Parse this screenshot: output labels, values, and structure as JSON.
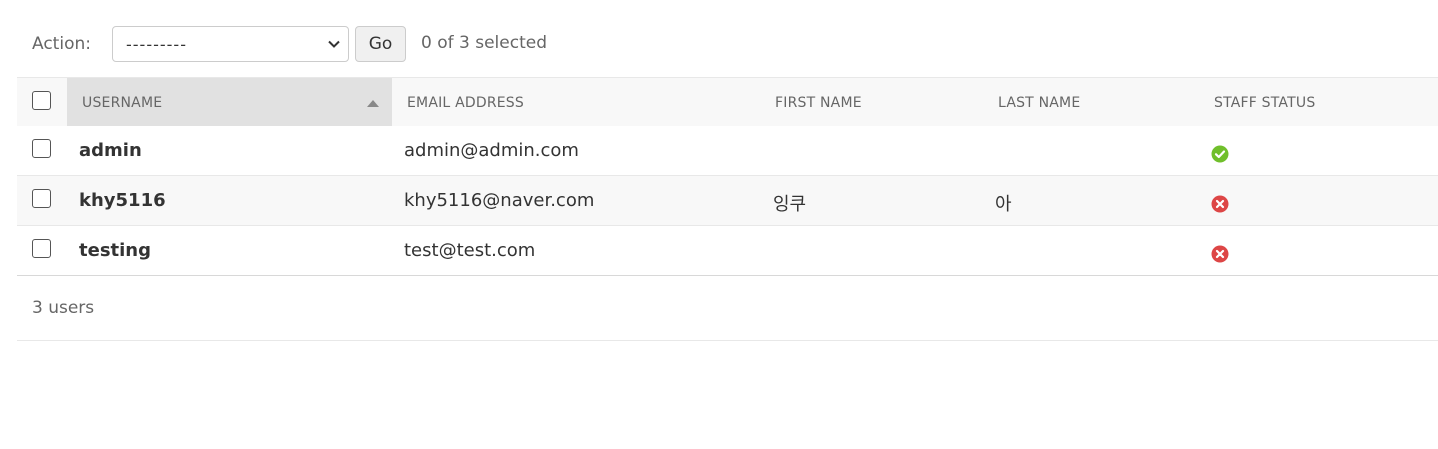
{
  "actions": {
    "label": "Action:",
    "select_value": "---------",
    "go_label": "Go",
    "selected_count": "0 of 3 selected"
  },
  "table": {
    "columns": [
      "Username",
      "Email address",
      "First name",
      "Last name",
      "Staff status"
    ],
    "sorted_column": "Username",
    "sort_direction": "ascending",
    "rows": [
      {
        "username": "admin",
        "email": "admin@admin.com",
        "first_name": "",
        "last_name": "",
        "staff_status": "yes",
        "staff_icon": "check-icon"
      },
      {
        "username": "khy5116",
        "email": "khy5116@naver.com",
        "first_name": "잉쿠",
        "last_name": "아",
        "staff_status": "no",
        "staff_icon": "x-icon"
      },
      {
        "username": "testing",
        "email": "test@test.com",
        "first_name": "",
        "last_name": "",
        "staff_status": "no",
        "staff_icon": "x-icon"
      }
    ]
  },
  "paginator": {
    "text": "3 users"
  },
  "colors": {
    "yes": "#70bf2b",
    "no": "#dd4646"
  }
}
